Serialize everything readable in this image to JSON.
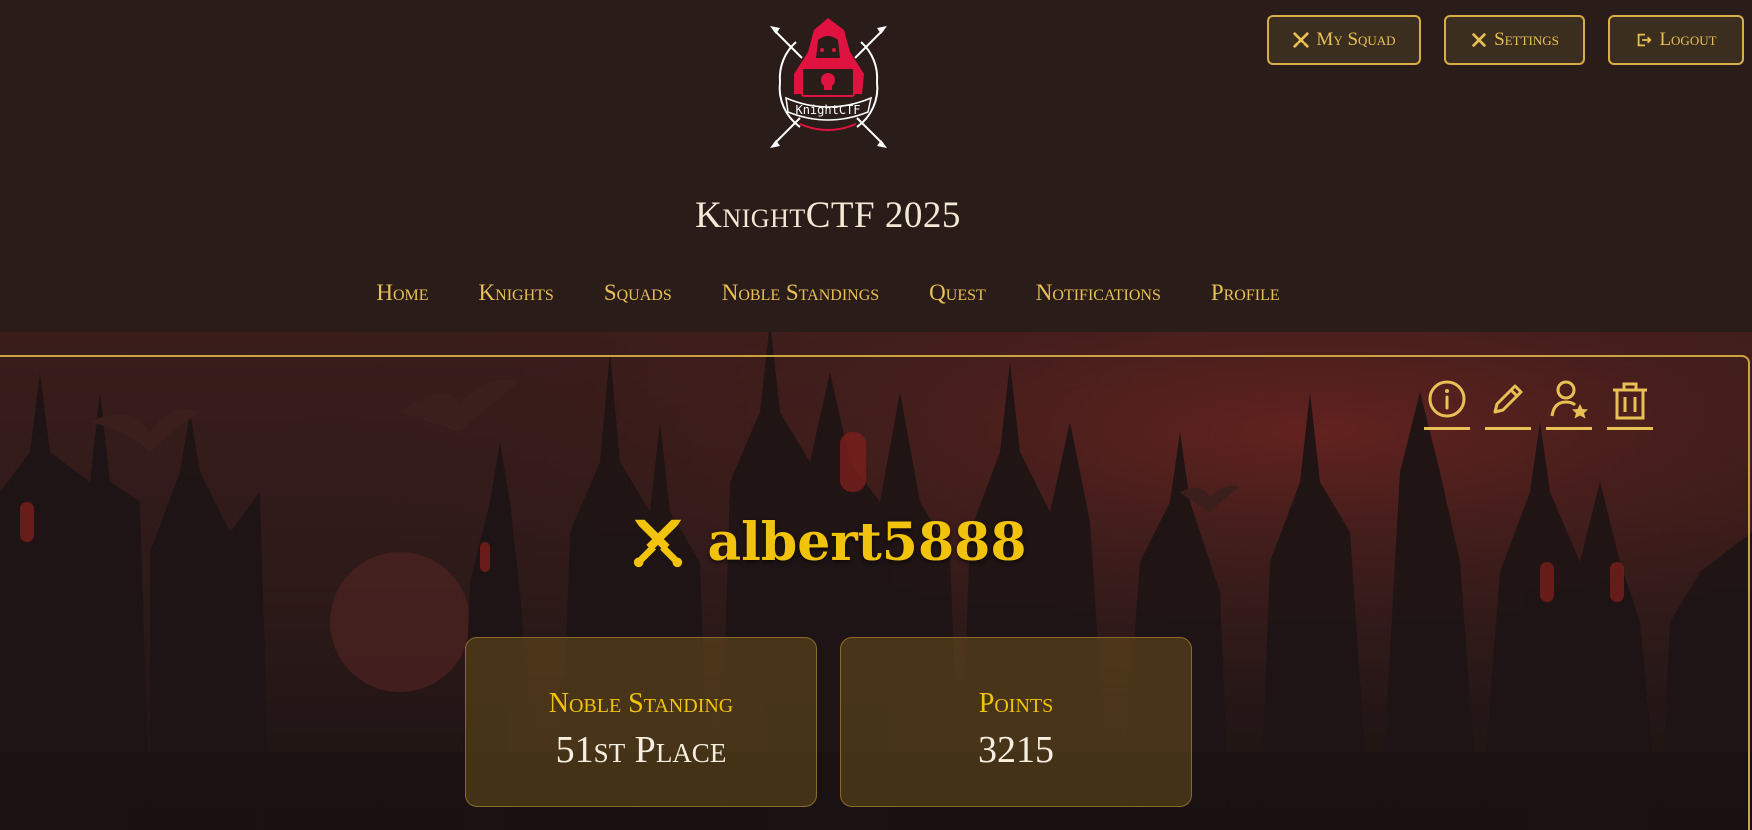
{
  "header": {
    "logo_text": "KnightCTF",
    "title": "KnightCTF 2025",
    "top_buttons": [
      {
        "label": "My Squad",
        "icon": "swords-icon"
      },
      {
        "label": "Settings",
        "icon": "wrench-icon"
      },
      {
        "label": "Logout",
        "icon": "logout-icon"
      }
    ]
  },
  "nav": {
    "items": [
      "Home",
      "Knights",
      "Squads",
      "Noble Standings",
      "Quest",
      "Notifications",
      "Profile"
    ]
  },
  "profile": {
    "username": "albert5888",
    "tools": [
      "info-icon",
      "edit-icon",
      "user-star-icon",
      "trash-icon"
    ],
    "stats": [
      {
        "label": "Noble Standing",
        "value": "51st Place"
      },
      {
        "label": "Points",
        "value": "3215"
      }
    ]
  },
  "colors": {
    "background": "#2a1c18",
    "gold": "#e9c055",
    "accent_yellow": "#f2c30c",
    "text_light": "#f3ead5"
  }
}
